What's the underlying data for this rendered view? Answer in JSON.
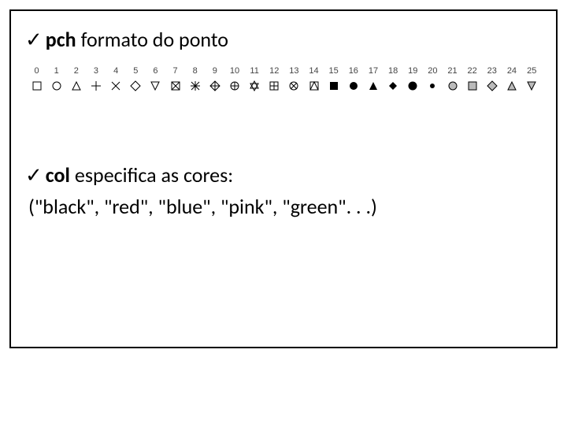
{
  "bullet1": {
    "check": "✓",
    "param": "pch",
    "text": "formato do ponto"
  },
  "pch": {
    "labels": [
      "0",
      "1",
      "2",
      "3",
      "4",
      "5",
      "6",
      "7",
      "8",
      "9",
      "10",
      "11",
      "12",
      "13",
      "14",
      "15",
      "16",
      "17",
      "18",
      "19",
      "20",
      "21",
      "22",
      "23",
      "24",
      "25"
    ]
  },
  "bullet2": {
    "check": "✓",
    "param": "col",
    "text": "especifica as cores:"
  },
  "colors_line": "(\"black\", \"red\", \"blue\", \"pink\", \"green\". . .)"
}
